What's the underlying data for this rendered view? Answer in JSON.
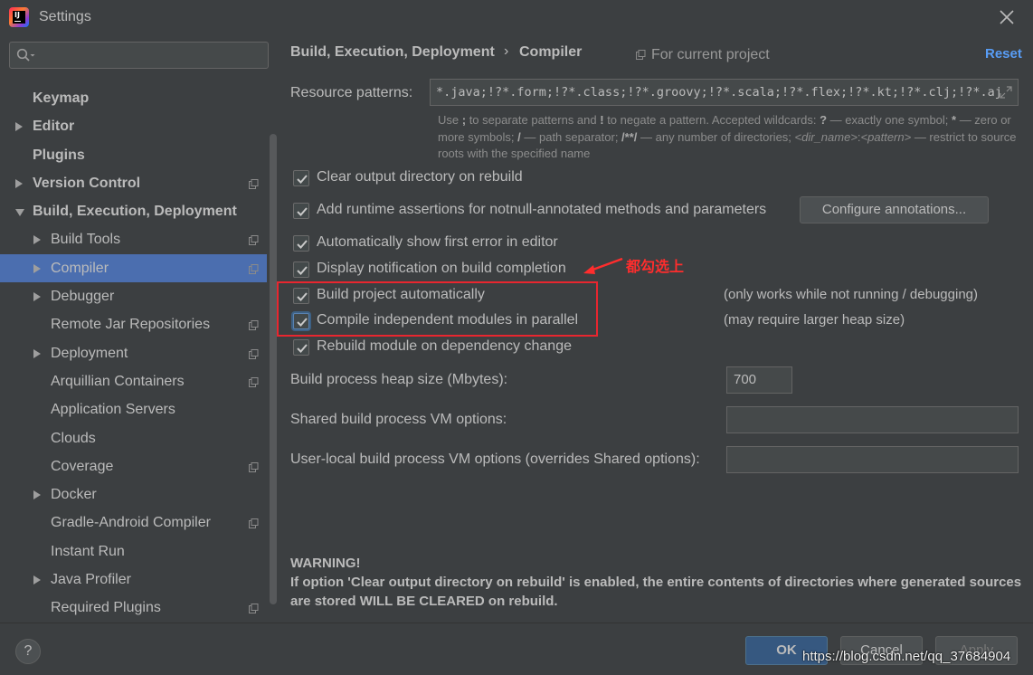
{
  "window": {
    "title": "Settings"
  },
  "search": {
    "placeholder": ""
  },
  "sidebar": {
    "items": [
      {
        "label": "Keymap",
        "bold": true,
        "arrow": "none",
        "indent": 0,
        "proj": false
      },
      {
        "label": "Editor",
        "bold": true,
        "arrow": "right",
        "indent": 0,
        "proj": false
      },
      {
        "label": "Plugins",
        "bold": true,
        "arrow": "none",
        "indent": 0,
        "proj": false
      },
      {
        "label": "Version Control",
        "bold": true,
        "arrow": "right",
        "indent": 0,
        "proj": true
      },
      {
        "label": "Build, Execution, Deployment",
        "bold": true,
        "arrow": "down",
        "indent": 0,
        "proj": false
      },
      {
        "label": "Build Tools",
        "bold": false,
        "arrow": "right",
        "indent": 1,
        "proj": true
      },
      {
        "label": "Compiler",
        "bold": false,
        "arrow": "right",
        "indent": 1,
        "proj": true,
        "selected": true
      },
      {
        "label": "Debugger",
        "bold": false,
        "arrow": "right",
        "indent": 1,
        "proj": false
      },
      {
        "label": "Remote Jar Repositories",
        "bold": false,
        "arrow": "none",
        "indent": 1,
        "proj": true
      },
      {
        "label": "Deployment",
        "bold": false,
        "arrow": "right",
        "indent": 1,
        "proj": true
      },
      {
        "label": "Arquillian Containers",
        "bold": false,
        "arrow": "none",
        "indent": 1,
        "proj": true
      },
      {
        "label": "Application Servers",
        "bold": false,
        "arrow": "none",
        "indent": 1,
        "proj": false
      },
      {
        "label": "Clouds",
        "bold": false,
        "arrow": "none",
        "indent": 1,
        "proj": false
      },
      {
        "label": "Coverage",
        "bold": false,
        "arrow": "none",
        "indent": 1,
        "proj": true
      },
      {
        "label": "Docker",
        "bold": false,
        "arrow": "right",
        "indent": 1,
        "proj": false
      },
      {
        "label": "Gradle-Android Compiler",
        "bold": false,
        "arrow": "none",
        "indent": 1,
        "proj": true
      },
      {
        "label": "Instant Run",
        "bold": false,
        "arrow": "none",
        "indent": 1,
        "proj": false
      },
      {
        "label": "Java Profiler",
        "bold": false,
        "arrow": "right",
        "indent": 1,
        "proj": false
      },
      {
        "label": "Required Plugins",
        "bold": false,
        "arrow": "none",
        "indent": 1,
        "proj": true
      }
    ]
  },
  "header": {
    "breadcrumb_parent": "Build, Execution, Deployment",
    "breadcrumb_sep": "›",
    "breadcrumb_current": "Compiler",
    "scope": "For current project",
    "reset": "Reset"
  },
  "resource": {
    "label": "Resource patterns:",
    "value": "*.java;!?*.form;!?*.class;!?*.groovy;!?*.scala;!?*.flex;!?*.kt;!?*.clj;!?*.aj"
  },
  "hint": {
    "p1": "Use ",
    "k1": ";",
    "p2": " to separate patterns and ",
    "k2": "!",
    "p3": " to negate a pattern. Accepted wildcards: ",
    "k3": "?",
    "p4": " — exactly one symbol; ",
    "k4": "*",
    "p5": " — zero or more symbols; ",
    "k5": "/",
    "p6": " — path separator; ",
    "k6": "/**/",
    "p7": " — any number of directories; ",
    "i1": "<dir_name>",
    "p8": ":",
    "i2": "<pattern>",
    "p9": " — restrict to source roots with the specified name"
  },
  "options": {
    "clear_output": {
      "label": "Clear output directory on rebuild",
      "checked": true
    },
    "runtime_assertions": {
      "label": "Add runtime assertions for notnull-annotated methods and parameters",
      "checked": true
    },
    "configure_annotations": "Configure annotations...",
    "show_first_error": {
      "label": "Automatically show first error in editor",
      "checked": true
    },
    "display_notification": {
      "label": "Display notification on build completion",
      "checked": true
    },
    "build_automatically": {
      "label": "Build project automatically",
      "checked": true,
      "note": "(only works while not running / debugging)"
    },
    "compile_parallel": {
      "label": "Compile independent modules in parallel",
      "checked": true,
      "note": "(may require larger heap size)"
    },
    "rebuild_on_change": {
      "label": "Rebuild module on dependency change",
      "checked": true
    }
  },
  "heap": {
    "label": "Build process heap size (Mbytes):",
    "value": "700"
  },
  "shared_vm": {
    "label": "Shared build process VM options:",
    "value": ""
  },
  "user_vm": {
    "label": "User-local build process VM options (overrides Shared options):",
    "value": ""
  },
  "annotation": {
    "text": "都勾选上",
    "color": "#ff2d2d"
  },
  "warning": {
    "title": "WARNING!",
    "body": "If option 'Clear output directory on rebuild' is enabled, the entire contents of directories where generated sources are stored WILL BE CLEARED on rebuild."
  },
  "footer": {
    "help": "?",
    "ok": "OK",
    "cancel": "Cancel",
    "apply": "Apply",
    "watermark": "https://blog.csdn.net/qq_37684904"
  },
  "colors": {
    "background": "#3c3f41",
    "selection": "#4b6eaf",
    "link": "#589df6",
    "highlight": "#e8262f"
  }
}
